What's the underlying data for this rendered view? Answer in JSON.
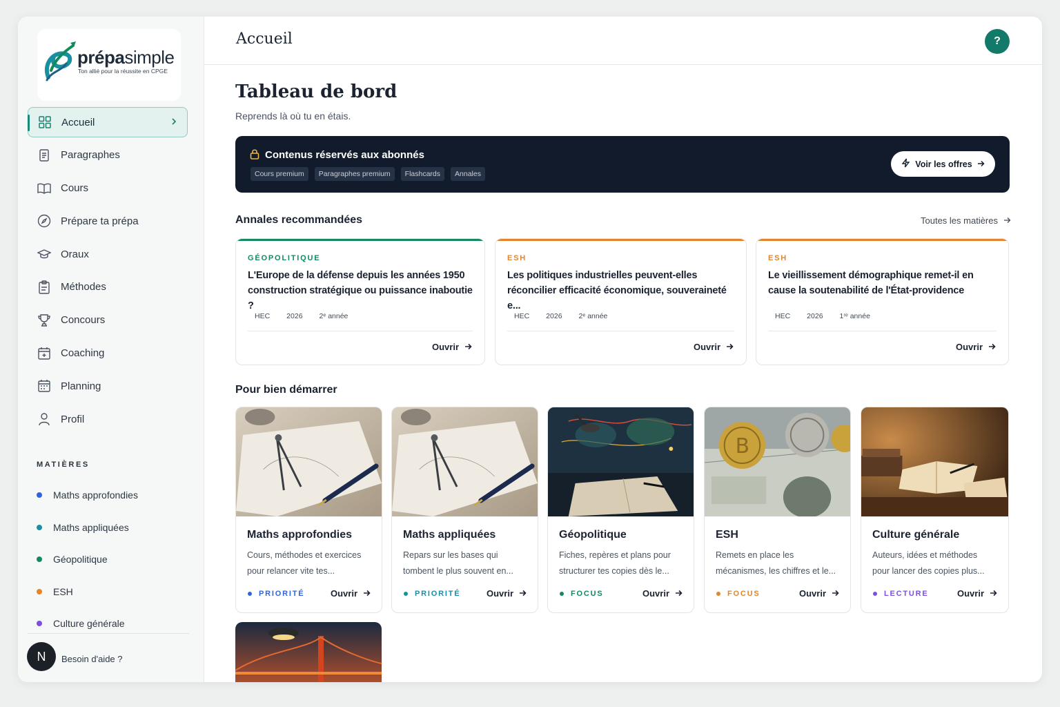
{
  "brand": {
    "name_bold": "prépa",
    "name_light": "simple",
    "tagline": "Ton allié pour la réussite en CPGE"
  },
  "sidebar": {
    "items": [
      {
        "label": "Accueil",
        "icon": "grid-icon"
      },
      {
        "label": "Paragraphes",
        "icon": "document-icon"
      },
      {
        "label": "Cours",
        "icon": "book-open-icon"
      },
      {
        "label": "Prépare ta prépa",
        "icon": "compass-icon"
      },
      {
        "label": "Oraux",
        "icon": "graduation-cap-icon"
      },
      {
        "label": "Méthodes",
        "icon": "clipboard-icon"
      },
      {
        "label": "Concours",
        "icon": "trophy-icon"
      },
      {
        "label": "Coaching",
        "icon": "calendar-plus-icon"
      },
      {
        "label": "Planning",
        "icon": "calendar-icon"
      },
      {
        "label": "Profil",
        "icon": "user-icon"
      }
    ],
    "subjects_title": "MATIÈRES",
    "subjects": [
      {
        "label": "Maths approfondies",
        "color": "#2f64e0"
      },
      {
        "label": "Maths appliquées",
        "color": "#1a8fa0"
      },
      {
        "label": "Géopolitique",
        "color": "#138a5e"
      },
      {
        "label": "ESH",
        "color": "#e3852a"
      },
      {
        "label": "Culture générale",
        "color": "#7d4fe0"
      }
    ],
    "avatar_letter": "N",
    "help_text": "Besoin d'aide ?"
  },
  "header": {
    "title": "Accueil",
    "help_button": "?"
  },
  "dashboard": {
    "title": "Tableau de bord",
    "subtitle": "Reprends là où tu en étais."
  },
  "banner": {
    "title": "Contenus réservés aux abonnés",
    "chips": [
      "Cours premium",
      "Paragraphes premium",
      "Flashcards",
      "Annales"
    ],
    "button": "Voir les offres"
  },
  "annales": {
    "title": "Annales recommandées",
    "all_link": "Toutes les matières",
    "cards": [
      {
        "tag": "GÉOPOLITIQUE",
        "color": "#138a5e",
        "title": "L'Europe de la défense depuis les années 1950 construction stratégique ou puissance inaboutie ?",
        "school": "HEC",
        "year": "2026",
        "level": "2ᵉ année",
        "open": "Ouvrir"
      },
      {
        "tag": "ESH",
        "color": "#e3852a",
        "title": "Les politiques industrielles peuvent-elles réconcilier efficacité économique, souveraineté e...",
        "school": "HEC",
        "year": "2026",
        "level": "2ᵉ année",
        "open": "Ouvrir"
      },
      {
        "tag": "ESH",
        "color": "#e3852a",
        "title": "Le vieillissement démographique remet-il en cause la soutenabilité de l'État-providence",
        "school": "HEC",
        "year": "2026",
        "level": "1ʳᵉ année",
        "open": "Ouvrir"
      }
    ]
  },
  "start": {
    "title": "Pour bien démarrer",
    "cards": [
      {
        "title": "Maths approfondies",
        "desc": "Cours, méthodes et exercices pour relancer vite tes...",
        "badge": "PRIORITÉ",
        "badge_color": "#2f64e0",
        "open": "Ouvrir"
      },
      {
        "title": "Maths appliquées",
        "desc": "Repars sur les bases qui tombent le plus souvent en...",
        "badge": "PRIORITÉ",
        "badge_color": "#1a8fa0",
        "open": "Ouvrir"
      },
      {
        "title": "Géopolitique",
        "desc": "Fiches, repères et plans pour structurer tes copies dès le...",
        "badge": "FOCUS",
        "badge_color": "#138a5e",
        "open": "Ouvrir"
      },
      {
        "title": "ESH",
        "desc": "Remets en place les mécanismes, les chiffres et le...",
        "badge": "FOCUS",
        "badge_color": "#e3852a",
        "open": "Ouvrir"
      },
      {
        "title": "Culture générale",
        "desc": "Auteurs, idées et méthodes pour lancer des copies plus...",
        "badge": "LECTURE",
        "badge_color": "#7d4fe0",
        "open": "Ouvrir"
      }
    ]
  }
}
